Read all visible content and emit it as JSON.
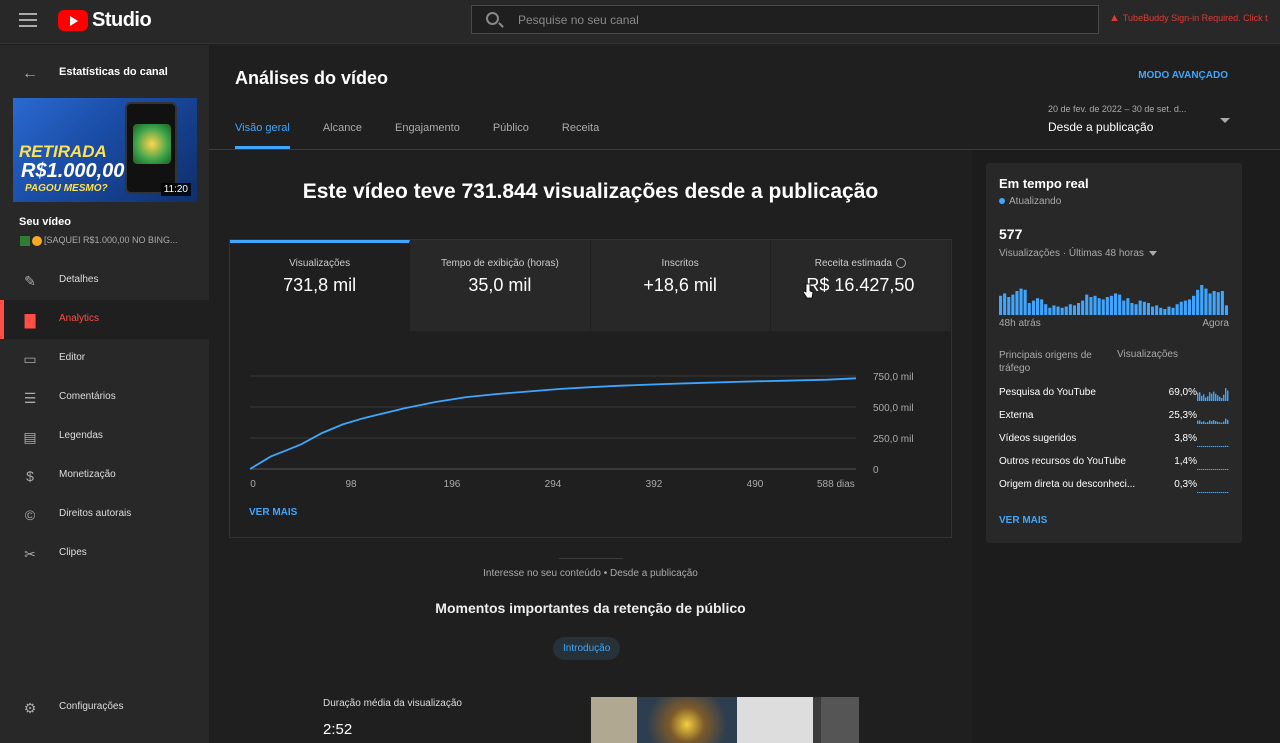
{
  "topbar": {
    "logo_text": "Studio",
    "search_placeholder": "Pesquise no seu canal",
    "warning_text": "TubeBuddy Sign-in Required. Click t"
  },
  "sidebar": {
    "title": "Estatísticas do canal",
    "thumbnail": {
      "line1": "RETIRADA",
      "line2": "R$1.000,00",
      "line3": "PAGOU MESMO?",
      "duration": "11:20"
    },
    "video_label": "Seu vídeo",
    "video_title": "[SAQUEI R$1.000,00 NO BING...",
    "items": [
      {
        "label": "Detalhes",
        "icon": "pencil-icon"
      },
      {
        "label": "Analytics",
        "icon": "analytics-icon",
        "active": true
      },
      {
        "label": "Editor",
        "icon": "editor-icon"
      },
      {
        "label": "Comentários",
        "icon": "comments-icon"
      },
      {
        "label": "Legendas",
        "icon": "subtitles-icon"
      },
      {
        "label": "Monetização",
        "icon": "dollar-icon"
      },
      {
        "label": "Direitos autorais",
        "icon": "copyright-icon"
      },
      {
        "label": "Clipes",
        "icon": "scissors-icon"
      }
    ],
    "settings_label": "Configurações"
  },
  "main": {
    "title": "Análises do vídeo",
    "advanced_mode": "MODO AVANÇADO",
    "tabs": [
      "Visão geral",
      "Alcance",
      "Engajamento",
      "Público",
      "Receita"
    ],
    "active_tab": "Visão geral",
    "date_range": "20 de fev. de 2022 – 30 de set. d...",
    "date_label": "Desde a publicação",
    "headline": "Este vídeo teve 731.844 visualizações desde a publicação",
    "metrics": [
      {
        "label": "Visualizações",
        "value": "731,8 mil"
      },
      {
        "label": "Tempo de exibição (horas)",
        "value": "35,0 mil"
      },
      {
        "label": "Inscritos",
        "value": "+18,6 mil"
      },
      {
        "label": "Receita estimada",
        "value": "R$ 16.427,50"
      }
    ],
    "see_more": "VER MAIS",
    "interest_text": "Interesse no seu conteúdo • Desde a publicação",
    "moments_title": "Momentos importantes da retenção de público",
    "chip_label": "Introdução",
    "avg_duration_label": "Duração média da visualização",
    "avg_duration_value": "2:52"
  },
  "chart_data": {
    "type": "line",
    "x_ticks": [
      "0",
      "98",
      "196",
      "294",
      "392",
      "490",
      "588 dias"
    ],
    "y_ticks": [
      "0",
      "250,0 mil",
      "500,0 mil",
      "750,0 mil"
    ],
    "ylim": [
      0,
      750000
    ],
    "xlim": [
      0,
      588
    ],
    "series": [
      {
        "x": [
          0,
          10,
          20,
          35,
          50,
          70,
          90,
          110,
          130,
          150,
          180,
          210,
          240,
          270,
          300,
          330,
          360,
          400,
          440,
          480,
          520,
          560,
          588
        ],
        "y": [
          0,
          50000,
          100000,
          150000,
          200000,
          290000,
          360000,
          410000,
          450000,
          490000,
          540000,
          580000,
          605000,
          625000,
          645000,
          660000,
          672000,
          685000,
          695000,
          705000,
          712000,
          720000,
          731844
        ]
      }
    ],
    "color": "#3ea6ff"
  },
  "realtime": {
    "title": "Em tempo real",
    "status": "Atualizando",
    "count": "577",
    "subtitle": "Visualizações · Últimas 48 horas",
    "bars": [
      16,
      18,
      15,
      17,
      20,
      22,
      21,
      10,
      12,
      14,
      13,
      9,
      6,
      8,
      7,
      6,
      7,
      9,
      8,
      10,
      12,
      17,
      15,
      16,
      14,
      13,
      15,
      16,
      18,
      17,
      12,
      14,
      10,
      9,
      12,
      11,
      10,
      7,
      8,
      6,
      5,
      7,
      6,
      9,
      11,
      12,
      13,
      16,
      21,
      25,
      22,
      18,
      20,
      19,
      20,
      8
    ],
    "x_start": "48h atrás",
    "x_end": "Agora",
    "traffic_header": "Principais origens de tráfego",
    "traffic_value_header": "Visualizações",
    "traffic": [
      {
        "name": "Pesquisa do YouTube",
        "pct": "69,0%",
        "share": 0.69
      },
      {
        "name": "Externa",
        "pct": "25,3%",
        "share": 0.253
      },
      {
        "name": "Vídeos sugeridos",
        "pct": "3,8%",
        "share": 0.038
      },
      {
        "name": "Outros recursos do YouTube",
        "pct": "1,4%",
        "share": 0.014
      },
      {
        "name": "Origem direta ou desconheci...",
        "pct": "0,3%",
        "share": 0.003
      }
    ],
    "see_more": "VER MAIS"
  }
}
